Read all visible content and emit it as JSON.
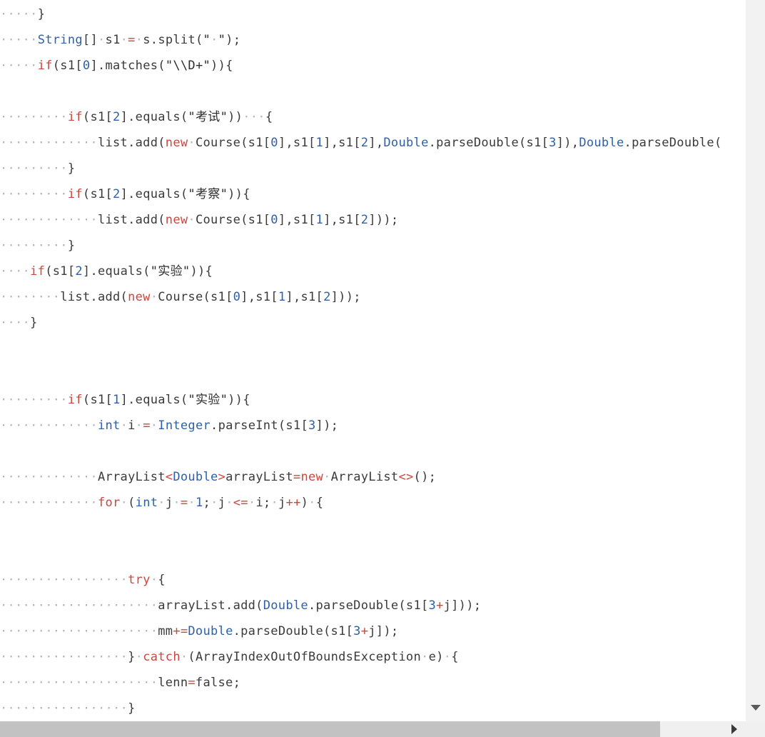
{
  "editor": {
    "lines": [
      [
        [
          "ws",
          "·····"
        ],
        [
          "plain",
          "}"
        ]
      ],
      [
        [
          "ws",
          "·····"
        ],
        [
          "type",
          "String"
        ],
        [
          "plain",
          "[]"
        ],
        [
          "ws",
          "·"
        ],
        [
          "plain",
          "s1"
        ],
        [
          "ws",
          "·"
        ],
        [
          "op",
          "="
        ],
        [
          "ws",
          "·"
        ],
        [
          "plain",
          "s.split("
        ],
        [
          "str",
          "\""
        ],
        [
          "ws",
          "·"
        ],
        [
          "str",
          "\""
        ],
        [
          "plain",
          ");"
        ]
      ],
      [
        [
          "ws",
          "·····"
        ],
        [
          "kw",
          "if"
        ],
        [
          "plain",
          "(s1["
        ],
        [
          "num",
          "0"
        ],
        [
          "plain",
          "].matches("
        ],
        [
          "str",
          "\"\\\\D+\""
        ],
        [
          "plain",
          "))"
        ],
        [
          "plain",
          "{"
        ]
      ],
      [],
      [
        [
          "ws",
          "·········"
        ],
        [
          "kw",
          "if"
        ],
        [
          "plain",
          "(s1["
        ],
        [
          "num",
          "2"
        ],
        [
          "plain",
          "].equals("
        ],
        [
          "str",
          "\""
        ],
        [
          "cjk",
          "考试"
        ],
        [
          "str",
          "\""
        ],
        [
          "plain",
          "))"
        ],
        [
          "ws",
          "···"
        ],
        [
          "plain",
          "{"
        ]
      ],
      [
        [
          "ws",
          "·············"
        ],
        [
          "plain",
          "list.add("
        ],
        [
          "kw",
          "new"
        ],
        [
          "ws",
          "·"
        ],
        [
          "plain",
          "Course(s1["
        ],
        [
          "num",
          "0"
        ],
        [
          "plain",
          "],s1["
        ],
        [
          "num",
          "1"
        ],
        [
          "plain",
          "],s1["
        ],
        [
          "num",
          "2"
        ],
        [
          "plain",
          "],"
        ],
        [
          "type",
          "Double"
        ],
        [
          "plain",
          ".parseDouble(s1["
        ],
        [
          "num",
          "3"
        ],
        [
          "plain",
          "]),"
        ],
        [
          "type",
          "Double"
        ],
        [
          "plain",
          ".parseDouble("
        ]
      ],
      [
        [
          "ws",
          "·········"
        ],
        [
          "plain",
          "}"
        ]
      ],
      [
        [
          "ws",
          "·········"
        ],
        [
          "kw",
          "if"
        ],
        [
          "plain",
          "(s1["
        ],
        [
          "num",
          "2"
        ],
        [
          "plain",
          "].equals("
        ],
        [
          "str",
          "\""
        ],
        [
          "cjk",
          "考察"
        ],
        [
          "str",
          "\""
        ],
        [
          "plain",
          "))"
        ],
        [
          "plain",
          "{"
        ]
      ],
      [
        [
          "ws",
          "·············"
        ],
        [
          "plain",
          "list.add("
        ],
        [
          "kw",
          "new"
        ],
        [
          "ws",
          "·"
        ],
        [
          "plain",
          "Course(s1["
        ],
        [
          "num",
          "0"
        ],
        [
          "plain",
          "],s1["
        ],
        [
          "num",
          "1"
        ],
        [
          "plain",
          "],s1["
        ],
        [
          "num",
          "2"
        ],
        [
          "plain",
          "]));"
        ]
      ],
      [
        [
          "ws",
          "·········"
        ],
        [
          "plain",
          "}"
        ]
      ],
      [
        [
          "ws",
          "····"
        ],
        [
          "kw",
          "if"
        ],
        [
          "plain",
          "(s1["
        ],
        [
          "num",
          "2"
        ],
        [
          "plain",
          "].equals("
        ],
        [
          "str",
          "\""
        ],
        [
          "cjk",
          "实验"
        ],
        [
          "str",
          "\""
        ],
        [
          "plain",
          "))"
        ],
        [
          "plain",
          "{"
        ]
      ],
      [
        [
          "ws",
          "········"
        ],
        [
          "plain",
          "list.add("
        ],
        [
          "kw",
          "new"
        ],
        [
          "ws",
          "·"
        ],
        [
          "plain",
          "Course(s1["
        ],
        [
          "num",
          "0"
        ],
        [
          "plain",
          "],s1["
        ],
        [
          "num",
          "1"
        ],
        [
          "plain",
          "],s1["
        ],
        [
          "num",
          "2"
        ],
        [
          "plain",
          "]));"
        ]
      ],
      [
        [
          "ws",
          "····"
        ],
        [
          "plain",
          "}"
        ]
      ],
      [],
      [],
      [
        [
          "ws",
          "·········"
        ],
        [
          "kw",
          "if"
        ],
        [
          "plain",
          "(s1["
        ],
        [
          "num",
          "1"
        ],
        [
          "plain",
          "].equals("
        ],
        [
          "str",
          "\""
        ],
        [
          "cjk",
          "实验"
        ],
        [
          "str",
          "\""
        ],
        [
          "plain",
          "))"
        ],
        [
          "plain",
          "{"
        ]
      ],
      [
        [
          "ws",
          "·············"
        ],
        [
          "type",
          "int"
        ],
        [
          "ws",
          "·"
        ],
        [
          "plain",
          "i"
        ],
        [
          "ws",
          "·"
        ],
        [
          "op",
          "="
        ],
        [
          "ws",
          "·"
        ],
        [
          "type",
          "Integer"
        ],
        [
          "plain",
          ".parseInt(s1["
        ],
        [
          "num",
          "3"
        ],
        [
          "plain",
          "]);"
        ]
      ],
      [],
      [
        [
          "ws",
          "·············"
        ],
        [
          "plain",
          "ArrayList"
        ],
        [
          "op",
          "<"
        ],
        [
          "type",
          "Double"
        ],
        [
          "op",
          ">"
        ],
        [
          "plain",
          "arrayList"
        ],
        [
          "op",
          "="
        ],
        [
          "kw",
          "new"
        ],
        [
          "ws",
          "·"
        ],
        [
          "plain",
          "ArrayList"
        ],
        [
          "op",
          "<>"
        ],
        [
          "plain",
          "();"
        ]
      ],
      [
        [
          "ws",
          "·············"
        ],
        [
          "kw",
          "for"
        ],
        [
          "ws",
          "·"
        ],
        [
          "plain",
          "("
        ],
        [
          "type",
          "int"
        ],
        [
          "ws",
          "·"
        ],
        [
          "plain",
          "j"
        ],
        [
          "ws",
          "·"
        ],
        [
          "op",
          "="
        ],
        [
          "ws",
          "·"
        ],
        [
          "num",
          "1"
        ],
        [
          "plain",
          ";"
        ],
        [
          "ws",
          "·"
        ],
        [
          "plain",
          "j"
        ],
        [
          "ws",
          "·"
        ],
        [
          "op",
          "<="
        ],
        [
          "ws",
          "·"
        ],
        [
          "plain",
          "i;"
        ],
        [
          "ws",
          "·"
        ],
        [
          "plain",
          "j"
        ],
        [
          "op",
          "++"
        ],
        [
          "plain",
          ")"
        ],
        [
          "ws",
          "·"
        ],
        [
          "plain",
          "{"
        ]
      ],
      [],
      [],
      [
        [
          "ws",
          "·················"
        ],
        [
          "kw",
          "try"
        ],
        [
          "ws",
          "·"
        ],
        [
          "plain",
          "{"
        ]
      ],
      [
        [
          "ws",
          "·····················"
        ],
        [
          "plain",
          "arrayList.add("
        ],
        [
          "type",
          "Double"
        ],
        [
          "plain",
          ".parseDouble(s1["
        ],
        [
          "num",
          "3"
        ],
        [
          "op",
          "+"
        ],
        [
          "plain",
          "j]));"
        ]
      ],
      [
        [
          "ws",
          "·····················"
        ],
        [
          "plain",
          "mm"
        ],
        [
          "op",
          "+="
        ],
        [
          "type",
          "Double"
        ],
        [
          "plain",
          ".parseDouble(s1["
        ],
        [
          "num",
          "3"
        ],
        [
          "op",
          "+"
        ],
        [
          "plain",
          "j]);"
        ]
      ],
      [
        [
          "ws",
          "·················"
        ],
        [
          "plain",
          "}"
        ],
        [
          "ws",
          "·"
        ],
        [
          "kw",
          "catch"
        ],
        [
          "ws",
          "·"
        ],
        [
          "plain",
          "(ArrayIndexOutOfBoundsException"
        ],
        [
          "ws",
          "·"
        ],
        [
          "plain",
          "e)"
        ],
        [
          "ws",
          "·"
        ],
        [
          "plain",
          "{"
        ]
      ],
      [
        [
          "ws",
          "·····················"
        ],
        [
          "plain",
          "lenn"
        ],
        [
          "op",
          "="
        ],
        [
          "plain",
          "false;"
        ]
      ],
      [
        [
          "ws",
          "·················"
        ],
        [
          "plain",
          "}"
        ]
      ]
    ]
  },
  "scrollbars": {
    "horizontal_thumb_fraction": 0.885,
    "down_arrow_icon": "triangle-down-icon",
    "right_arrow_icon": "triangle-right-icon"
  },
  "colors": {
    "keyword": "#c9483f",
    "type": "#2e5fa8",
    "number": "#2e5fa8",
    "whitespace_marker": "#b5b5b5",
    "text": "#3a3a3a"
  }
}
